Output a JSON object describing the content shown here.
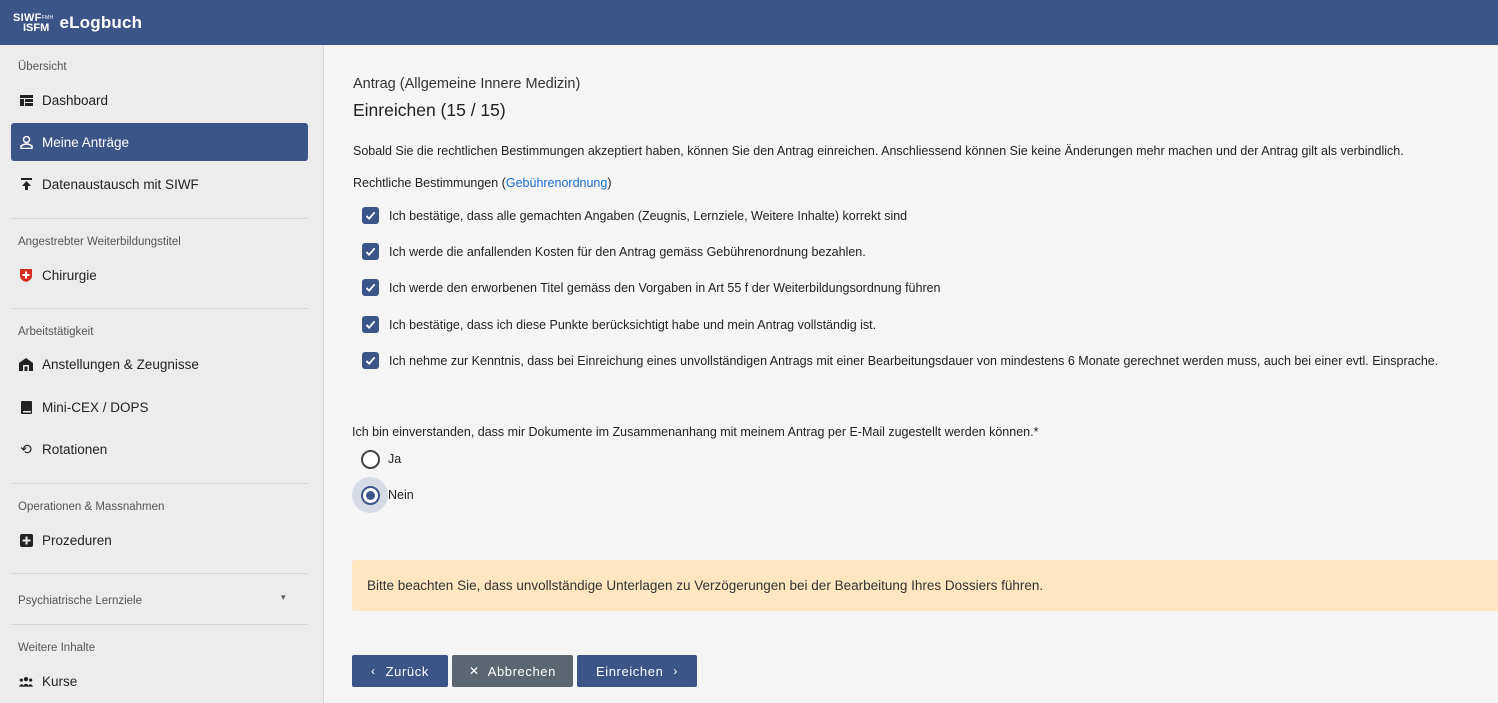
{
  "app": {
    "logo_line1": "SIWF",
    "logo_small": "FMH",
    "logo_line2": "ISFM",
    "title": "eLogbuch"
  },
  "sidebar": {
    "sections": [
      {
        "title": "Übersicht"
      },
      {
        "title": "Angestrebter Weiterbildungstitel"
      },
      {
        "title": "Arbeitstätigkeit"
      },
      {
        "title": "Operationen & Massnahmen"
      },
      {
        "title": "Psychiatrische Lernziele"
      },
      {
        "title": "Weitere Inhalte"
      }
    ],
    "items": [
      {
        "label": "Dashboard",
        "icon": "dashboard-icon"
      },
      {
        "label": "Meine Anträge",
        "icon": "user-file-icon"
      },
      {
        "label": "Datenaustausch mit SIWF",
        "icon": "upload-icon"
      },
      {
        "label": "Chirurgie",
        "icon": "swiss-shield-icon"
      },
      {
        "label": "Anstellungen & Zeugnisse",
        "icon": "building-icon"
      },
      {
        "label": "Mini-CEX / DOPS",
        "icon": "book-icon"
      },
      {
        "label": "Rotationen",
        "icon": "rotate-icon"
      },
      {
        "label": "Prozeduren",
        "icon": "plus-square-icon"
      },
      {
        "label": "Kurse",
        "icon": "users-icon"
      }
    ],
    "caret": "▾"
  },
  "main": {
    "subtitle": "Antrag (Allgemeine Innere Medizin)",
    "title": "Einreichen (15 / 15)",
    "intro": "Sobald Sie die rechtlichen Bestimmungen akzeptiert haben, können Sie den Antrag einreichen. Anschliessend können Sie keine Änderungen mehr machen und der Antrag gilt als verbindlich.",
    "legal_prefix": "Rechtliche Bestimmungen (",
    "legal_link": "Gebührenordnung",
    "legal_suffix": ")",
    "checkboxes": [
      {
        "label": "Ich bestätige, dass alle gemachten Angaben (Zeugnis, Lernziele, Weitere Inhalte) korrekt sind",
        "checked": true
      },
      {
        "label": "Ich werde die anfallenden Kosten für den Antrag gemäss Gebührenordnung bezahlen.",
        "checked": true
      },
      {
        "label": "Ich werde den erworbenen Titel gemäss den Vorgaben in Art 55 f der Weiterbildungsordnung führen",
        "checked": true
      },
      {
        "label": "Ich bestätige, dass ich diese Punkte berücksichtigt habe und mein Antrag vollständig ist.",
        "checked": true
      },
      {
        "label": "Ich nehme zur Kenntnis, dass bei Einreichung eines unvollständigen Antrags mit einer Bearbeitungsdauer von mindestens 6 Monate gerechnet werden muss, auch bei einer evtl. Einsprache.",
        "checked": true
      }
    ],
    "consent_question": "Ich bin einverstanden, dass mir Dokumente im Zusammenanhang mit meinem Antrag per E-Mail zugestellt werden können.*",
    "radio_options": [
      {
        "label": "Ja",
        "checked": false
      },
      {
        "label": "Nein",
        "checked": true
      }
    ],
    "alert": "Bitte beachten Sie, dass unvollständige Unterlagen zu Verzögerungen bei der Bearbeitung Ihres Dossiers führen.",
    "buttons": {
      "back": "Zurück",
      "cancel": "Abbrechen",
      "submit": "Einreichen"
    }
  },
  "colors": {
    "primary": "#3c5589",
    "alert_bg": "#fde6c0",
    "link": "#1a6fd1",
    "cancel": "#5c6670"
  }
}
